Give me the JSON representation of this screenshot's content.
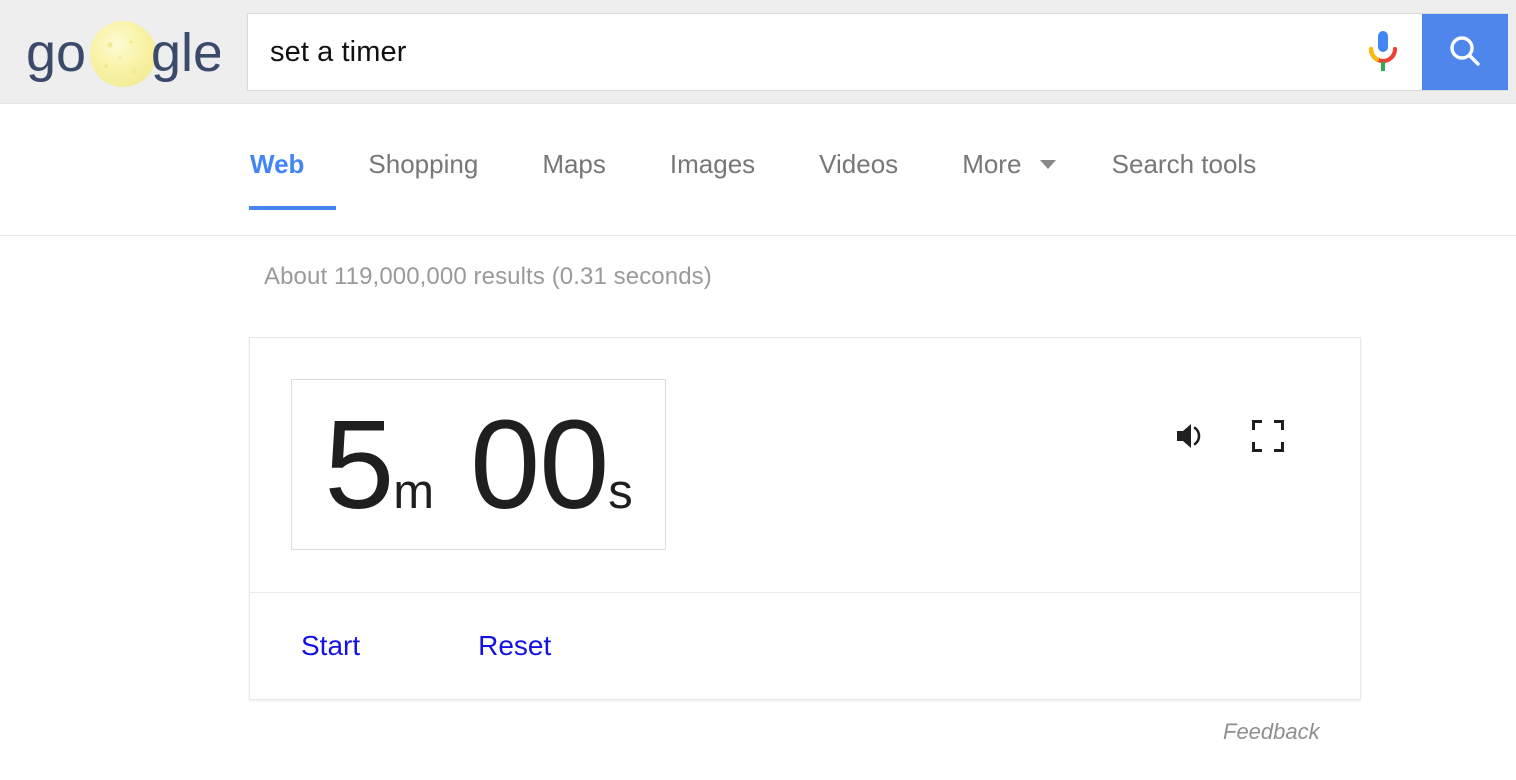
{
  "header": {
    "logo": {
      "name": "google-doodle-logo",
      "text_before": "go",
      "text_after": "gle",
      "letter_color": "#3b4a6b",
      "moon_color": "#f6f0a0"
    },
    "search": {
      "value": "set a timer",
      "placeholder": "Search",
      "mic_icon": "microphone-icon",
      "search_icon": "search-icon",
      "button_color": "#4e86ec"
    }
  },
  "tabs": {
    "items": [
      {
        "label": "Web",
        "active": true
      },
      {
        "label": "Shopping",
        "active": false
      },
      {
        "label": "Maps",
        "active": false
      },
      {
        "label": "Images",
        "active": false
      },
      {
        "label": "Videos",
        "active": false
      },
      {
        "label": "More",
        "active": false,
        "caret": true
      },
      {
        "label": "Search tools",
        "active": false
      }
    ],
    "active_color": "#4285f4",
    "inactive_color": "#777777"
  },
  "results": {
    "stats": "About 119,000,000 results (0.31 seconds)"
  },
  "timer": {
    "minutes": "5",
    "minutes_unit": "m",
    "seconds": "00",
    "seconds_unit": "s",
    "sound_icon": "speaker-volume-icon",
    "fullscreen_icon": "fullscreen-icon",
    "start_label": "Start",
    "reset_label": "Reset",
    "link_color": "#1412e0"
  },
  "footer": {
    "feedback_label": "Feedback"
  }
}
